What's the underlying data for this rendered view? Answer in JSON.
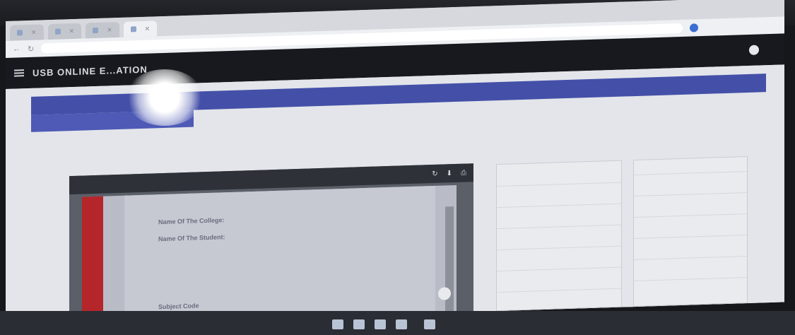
{
  "browser": {
    "tabs": [
      {
        "label": "",
        "active": false
      },
      {
        "label": "",
        "active": false
      },
      {
        "label": "",
        "active": false
      },
      {
        "label": "",
        "active": true
      }
    ],
    "url": ""
  },
  "app": {
    "title": "USB ONLINE E...ATION",
    "session": "",
    "user": ""
  },
  "main": {
    "banner_button": "",
    "banner_subtitle": "",
    "warning": "",
    "info": {
      "left": "",
      "center": "",
      "right_a": "",
      "right_b": ""
    }
  },
  "viewer": {
    "filename": "",
    "zoom": "",
    "fields": {
      "name_of_college": "Name Of The College:",
      "name_of_student": "Name Of The Student:",
      "roll": "",
      "programme": "",
      "subject": "",
      "subject_code": "Subject Code"
    }
  },
  "colors": {
    "appbar": "#17191e",
    "banner": "#4450a8",
    "accent_red": "#b5262a"
  }
}
